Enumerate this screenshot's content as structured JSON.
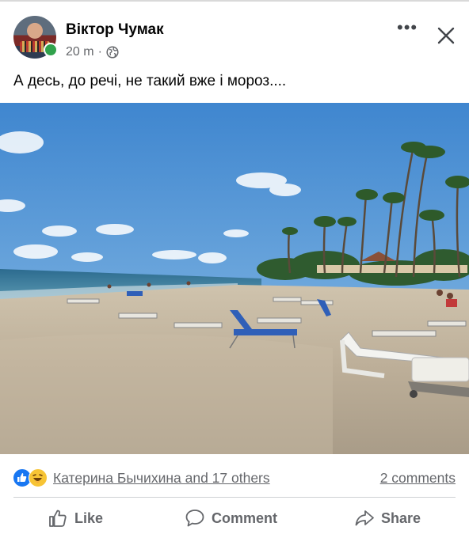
{
  "post": {
    "author": "Віктор Чумак",
    "time": "20 m",
    "separator": "·",
    "visibility_icon": "globe-icon",
    "text": "А десь, до речі, не такий вже і мороз...."
  },
  "header_controls": {
    "more_icon": "more-options-icon",
    "close_icon": "close-icon"
  },
  "reactions": {
    "types": [
      "like",
      "haha"
    ],
    "summary": "Катерина Бычихина and 17 others",
    "comments": "2 comments"
  },
  "actions": {
    "like": "Like",
    "comment": "Comment",
    "share": "Share"
  },
  "colors": {
    "accent": "#1877f2",
    "online": "#31a24c",
    "secondary_text": "#65676b"
  }
}
